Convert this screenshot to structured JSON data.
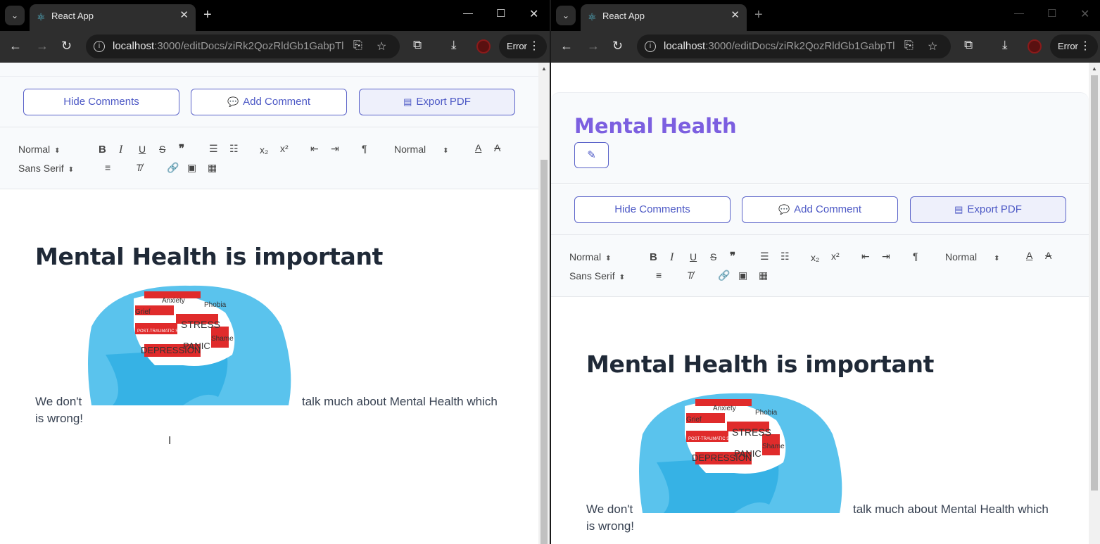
{
  "browser": {
    "tab_title": "React App",
    "url_host": "localhost",
    "url_rest": ":3000/editDocs/ziRk2QozRldGb1GabpTl",
    "error_label": "Error"
  },
  "doc": {
    "title": "Mental Health",
    "buttons": {
      "hide_comments": "Hide Comments",
      "add_comment": "Add Comment",
      "export_pdf": "Export PDF"
    },
    "toolbar": {
      "header_select": "Normal",
      "size_select": "Normal",
      "font_select": "Sans Serif"
    },
    "heading": "Mental Health is important",
    "para_before": "We don't",
    "para_after": "talk much about Mental Health which",
    "para_line2": "is wrong!",
    "image_words": [
      "Anxiety",
      "Phobia",
      "Grief",
      "STRESS",
      "POST-TRAUMATIC STRESS",
      "Shame",
      "DEPRESSION",
      "PANIC"
    ]
  },
  "colors": {
    "accent": "#4c58c5",
    "title": "#7c5fe0",
    "chrome_bg": "#000000",
    "toolbar_bg": "#2e2e2e"
  }
}
